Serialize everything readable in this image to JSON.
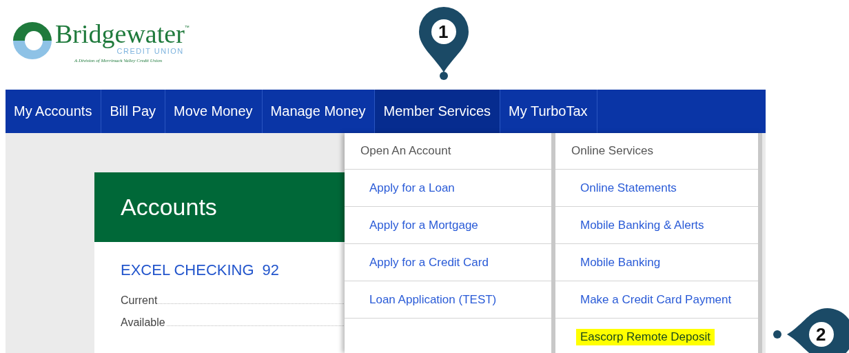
{
  "logo": {
    "name": "Bridgewater",
    "trademark": "™",
    "subtitle": "CREDIT UNION",
    "tagline": "A Division of Merrimack Valley Credit Union"
  },
  "nav": [
    {
      "label": "My Accounts",
      "selected": false
    },
    {
      "label": "Bill Pay",
      "selected": false
    },
    {
      "label": "Move Money",
      "selected": false
    },
    {
      "label": "Manage Money",
      "selected": false
    },
    {
      "label": "Member Services",
      "selected": true
    },
    {
      "label": "My TurboTax",
      "selected": false
    }
  ],
  "dropdown": {
    "columns": [
      {
        "heading": "Open An Account",
        "items": [
          {
            "label": "Apply for a Loan",
            "highlighted": false
          },
          {
            "label": "Apply for a Mortgage",
            "highlighted": false
          },
          {
            "label": "Apply for a Credit Card",
            "highlighted": false
          },
          {
            "label": "Loan Application (TEST)",
            "highlighted": false
          }
        ]
      },
      {
        "heading": "Online Services",
        "items": [
          {
            "label": "Online Statements",
            "highlighted": false
          },
          {
            "label": "Mobile Banking & Alerts",
            "highlighted": false
          },
          {
            "label": "Mobile Banking",
            "highlighted": false
          },
          {
            "label": "Make a Credit Card Payment",
            "highlighted": false
          },
          {
            "label": "Eascorp Remote Deposit",
            "highlighted": true
          }
        ]
      }
    ]
  },
  "accounts_card": {
    "title": "Accounts",
    "account": {
      "name": "EXCEL CHECKING",
      "number": "92"
    },
    "balances": [
      "Current",
      "Available"
    ]
  },
  "callouts": [
    {
      "number": "1",
      "kind": "pin-down"
    },
    {
      "number": "2",
      "kind": "pin-left"
    }
  ]
}
